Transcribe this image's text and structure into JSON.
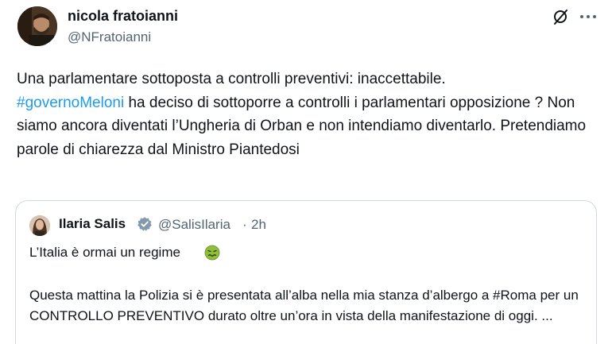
{
  "author": {
    "name": "nicola fratoianni",
    "handle": "@NFratoianni"
  },
  "tweet": {
    "text_before": "Una parlamentare sottoposta a controlli preventivi: inaccettabile.",
    "hashtag": "#governoMeloni",
    "text_after": " ha deciso di sottoporre a controlli i parlamentari opposizione ? Non siamo ancora diventati l’Ungheria di Orban e non intendiamo diventarlo. Pretendiamo parole di chiarezza dal Ministro Piantedosi"
  },
  "quote": {
    "name": "Ilaria Salis",
    "handle": "@SalisIlaria",
    "separator": "·",
    "time": "2h",
    "line1": "L’Italia è ormai un regime",
    "body": "Questa mattina la Polizia si è presentata all’alba nella mia stanza d’albergo a #Roma per un CONTROLLO PREVENTIVO durato oltre un’ora in vista della manifestazione di oggi. ..."
  },
  "icons": {
    "grok": "grok-icon",
    "more": "more-icon",
    "verified": "verified-badge-icon",
    "emoji": "nauseated-face-emoji"
  },
  "colors": {
    "hashtag": "#1d9bf0",
    "secondary": "#536471",
    "verified": "#829aab",
    "border": "#cfd9de"
  }
}
